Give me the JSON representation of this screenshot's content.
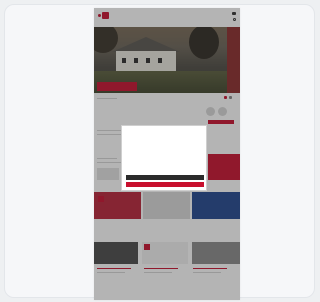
{
  "window": {
    "background": "#eef0f2",
    "accent": "#c8102e"
  },
  "site": {
    "logo_icon": "logo-mark-icon",
    "brand": "",
    "nav": [
      {
        "label": ""
      },
      {
        "label": ""
      },
      {
        "label": ""
      },
      {
        "label": ""
      }
    ],
    "search_icon": "search-icon"
  },
  "hero": {
    "caption": ""
  },
  "section": {
    "title": "",
    "subtitle": ""
  },
  "cookie_dialog": {
    "title": "",
    "body": "",
    "link": "",
    "options": "",
    "secondary_button": "",
    "primary_button": ""
  },
  "tiles": [
    {
      "label": ""
    },
    {
      "label": ""
    },
    {
      "label": ""
    }
  ]
}
